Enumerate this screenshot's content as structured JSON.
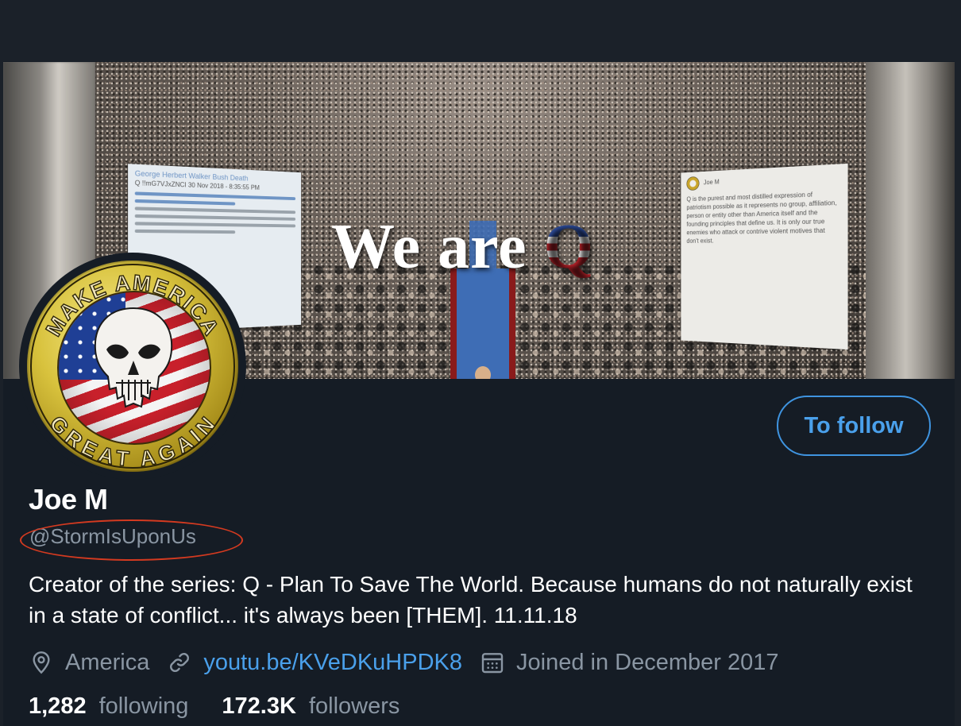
{
  "banner": {
    "headline_prefix": "We are ",
    "headline_q": "Q",
    "left_card": {
      "title": "George Herbert Walker Bush Death",
      "meta": "Q !!mG7VJxZNCI 30 Nov 2018 - 8:35:55 PM"
    },
    "right_card": {
      "name": "Joe M",
      "text": "Q is the purest and most distilled expression of patriotism possible as it represents no group, affiliation, person or entity other than America itself and the founding principles that define us. It is only our true enemies who attack or contrive violent motives that don't exist."
    }
  },
  "avatar": {
    "ring_text_top": "MAKE AMERICA",
    "ring_text_bottom": "GREAT AGAIN"
  },
  "profile": {
    "follow_label": "To follow",
    "display_name": "Joe M",
    "handle": "@StormIsUponUs",
    "bio": "Creator of the series: Q - Plan To Save The World. Because humans do not naturally exist in a state of conflict... it's always been [THEM]. 11.11.18",
    "location": "America",
    "website": "youtu.be/KVeDKuHPDK8",
    "joined": "Joined in December 2017",
    "following_count": "1,282",
    "following_label": "following",
    "followers_count": "172.3K",
    "followers_label": "followers"
  },
  "colors": {
    "accent": "#4aa0eb",
    "background": "#151c25",
    "secondary_text": "#8a96a3",
    "highlight_circle": "#d43a20"
  },
  "icons": {
    "location": "location-pin-icon",
    "website": "link-icon",
    "joined": "calendar-icon"
  }
}
